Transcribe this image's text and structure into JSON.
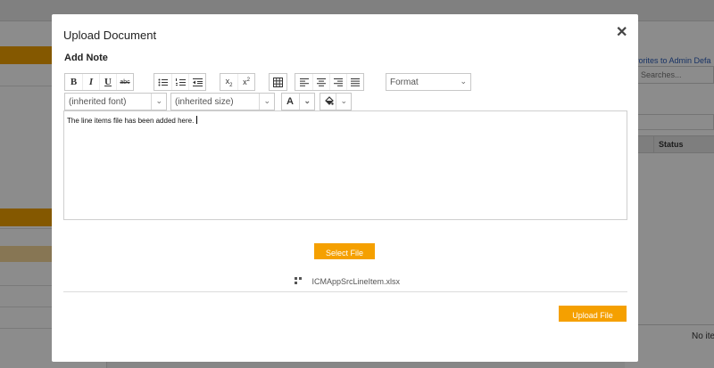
{
  "background": {
    "favorites_text": "avorites to Admin Defa",
    "search_placeholder": "Searches...",
    "status_header": "Status",
    "no_items_text": "No ite"
  },
  "modal": {
    "title": "Upload Document",
    "close_icon": "close-icon",
    "note_label": "Add Note"
  },
  "toolbar": {
    "bold": "B",
    "italic": "I",
    "underline": "U",
    "strikethrough": "abc",
    "format_select": "Format",
    "font_select": "(inherited font)",
    "size_select": "(inherited size)",
    "font_color": "A"
  },
  "editor": {
    "content": "The line items file has been added here."
  },
  "actions": {
    "select_file": "Select File",
    "file_name": "ICMAppSrcLineItem.xlsx",
    "upload_file": "Upload File"
  },
  "colors": {
    "accent": "#f5a000"
  }
}
